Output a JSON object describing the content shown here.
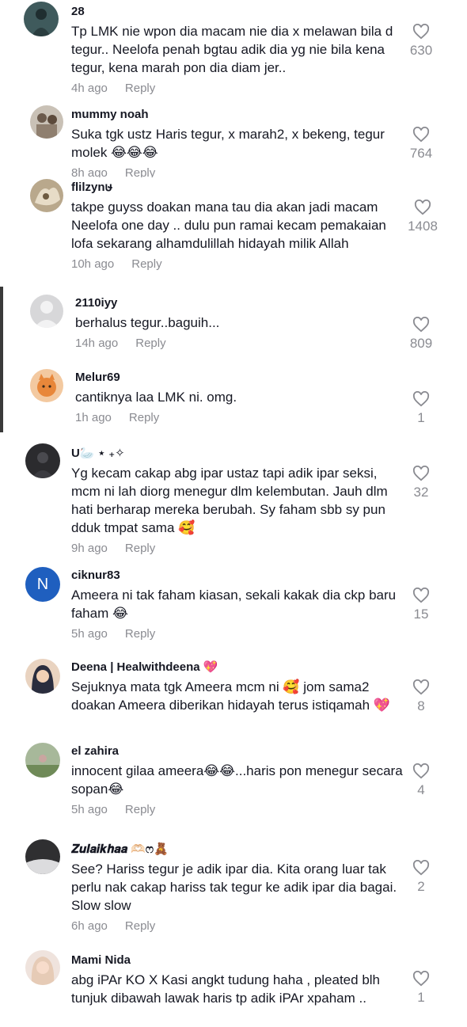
{
  "comments": [
    {
      "username": "28",
      "text": "Tp LMK nie wpon dia macam nie dia x melawan bila d tegur.. Neelofa penah bgtau adik dia yg nie bila kena tegur, kena marah pon dia diam jer..",
      "time": "4h ago",
      "reply": "Reply",
      "likes": "630"
    },
    {
      "username": "mummy noah",
      "text": "Suka tgk ustz Haris tegur, x marah2, x bekeng, tegur molek 😂😂😂",
      "time": "8h ago",
      "reply": "Reply",
      "likes": "764"
    },
    {
      "username": "flilzynຩ",
      "text": "takpe guyss doakan mana tau dia akan jadi macam Neelofa one day .. dulu pun ramai kecam pemakaian lofa sekarang alhamdulillah hidayah milik Allah",
      "time": "10h ago",
      "reply": "Reply",
      "likes": "1408"
    },
    {
      "username": "2110iyy",
      "text": "berhalus tegur..baguih...",
      "time": "14h ago",
      "reply": "Reply",
      "likes": "809"
    },
    {
      "username": "Melur69",
      "text": "cantiknya laa LMK ni. omg.",
      "time": "1h ago",
      "reply": "Reply",
      "likes": "1"
    },
    {
      "username": "U🦢 ⋆ ₊✧",
      "text": "Yg kecam cakap abg ipar ustaz tapi adik ipar seksi, mcm ni lah diorg menegur dlm kelembutan. Jauh dlm hati berharap mereka berubah. Sy faham sbb sy pun dduk tmpat sama 🥰",
      "time": "9h ago",
      "reply": "Reply",
      "likes": "32"
    },
    {
      "username": "ciknur83",
      "avatar_letter": "N",
      "text": "Ameera ni tak faham kiasan, sekali kakak dia ckp baru faham 😂",
      "time": "5h ago",
      "reply": "Reply",
      "likes": "15"
    },
    {
      "username": "Deena | Healwithdeena 💖",
      "text": "Sejuknya mata tgk Ameera mcm ni 🥰 jom sama2 doakan Ameera diberikan hidayah terus istiqamah 💖",
      "time": "",
      "reply": "",
      "likes": "8"
    },
    {
      "username": "el zahira",
      "text": "innocent gilaa ameera😂😂...haris pon menegur secara sopan😂",
      "time": "5h ago",
      "reply": "Reply",
      "likes": "4"
    },
    {
      "username": "𝒁𝒖𝒍𝒂𝒊𝒌𝒉𝒂𝒂 🫶🏻ෆ🧸",
      "text": "See? Hariss tegur je adik ipar dia. Kita orang luar tak perlu nak cakap hariss tak tegur ke adik ipar dia bagai. Slow slow",
      "time": "6h ago",
      "reply": "Reply",
      "likes": "2"
    },
    {
      "username": "Mami Nida",
      "text": "abg iPAr KO X Kasi angkt tudung haha , pleated blh tunjuk dibawah lawak haris tp adik iPAr xpaham ..",
      "time": "",
      "reply": "",
      "likes": "1"
    }
  ],
  "colors": {
    "text": "#161823",
    "muted": "#8a8b91",
    "avatar_letter_bg": "#1f5fbf"
  }
}
